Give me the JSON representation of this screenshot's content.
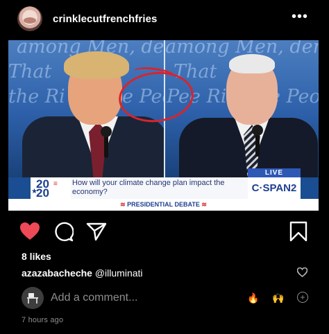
{
  "post": {
    "username": "crinklecutfrenchfries",
    "more_icon": "ellipsis-icon"
  },
  "image": {
    "backdrop_text_left": [
      "among Men, deriv",
      "That",
      "the Ri",
      "e Pee"
    ],
    "backdrop_text_right": [
      "among Men, deriv",
      "That",
      "Pee Rig",
      "e Peop"
    ],
    "lower_third": {
      "logo_year_top": "20",
      "logo_year_bottom": "20",
      "question": "How will your climate change plan impact the economy?",
      "live_label": "LIVE",
      "network": "C·SPAN2",
      "banner": "PRESIDENTIAL DEBATE"
    },
    "annotation_color": "#d9242c"
  },
  "actions": {
    "like_icon": "heart-filled-icon",
    "comment_icon": "comment-bubble-icon",
    "share_icon": "paper-plane-icon",
    "save_icon": "bookmark-icon",
    "like_color": "#ed4956"
  },
  "likes": "8 likes",
  "caption": {
    "user": "azazabacheche",
    "text": " @illuminati"
  },
  "comment": {
    "placeholder": "Add a comment...",
    "emoji_1": "🔥",
    "emoji_2": "🙌",
    "plus": "+"
  },
  "timestamp": "7 hours ago"
}
